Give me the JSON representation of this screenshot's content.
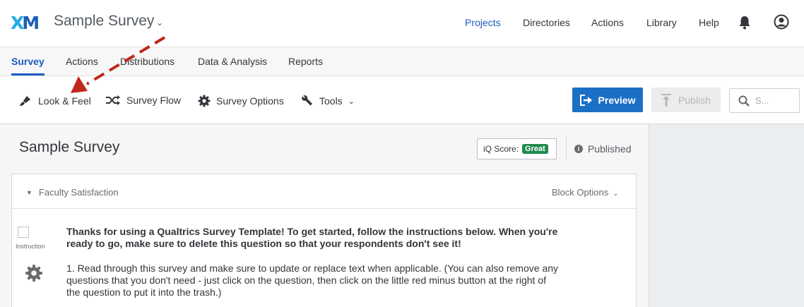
{
  "header": {
    "logo": {
      "x": "X",
      "m": "M"
    },
    "project_title": "Sample Survey",
    "nav": [
      "Projects",
      "Directories",
      "Actions",
      "Library",
      "Help"
    ],
    "active_nav": "Projects",
    "icons": [
      "bell-icon",
      "user-account-icon"
    ]
  },
  "tabs": {
    "items": [
      "Survey",
      "Actions",
      "Distributions",
      "Data & Analysis",
      "Reports"
    ],
    "active": "Survey"
  },
  "toolbar": {
    "look_feel": "Look & Feel",
    "survey_flow": "Survey Flow",
    "survey_options": "Survey Options",
    "tools": "Tools",
    "preview": "Preview",
    "publish": "Publish",
    "search_placeholder": "S..."
  },
  "editor": {
    "survey_title": "Sample Survey",
    "iq_label": "iQ Score:",
    "iq_value": "Great",
    "status": "Published"
  },
  "block": {
    "name": "Faculty Satisfaction",
    "options_label": "Block Options",
    "question": {
      "type_label": "Instruction",
      "bold_text": "Thanks for using a Qualtrics Survey Template! To get started, follow the instructions below. When you're ready to go, make sure to delete this question so that your respondents don't see it!",
      "body_text": "1. Read through this survey and make sure to update or replace text when applicable. (You can also remove any questions that you don't need - just click on the question, then click on the little red minus button at the right of the question to put it into the trash.)"
    }
  },
  "colors": {
    "accent": "#1d5bbf",
    "preview_button": "#1b70c6",
    "iq_badge": "#1e8a4d",
    "annotation_arrow": "#c0281c"
  }
}
